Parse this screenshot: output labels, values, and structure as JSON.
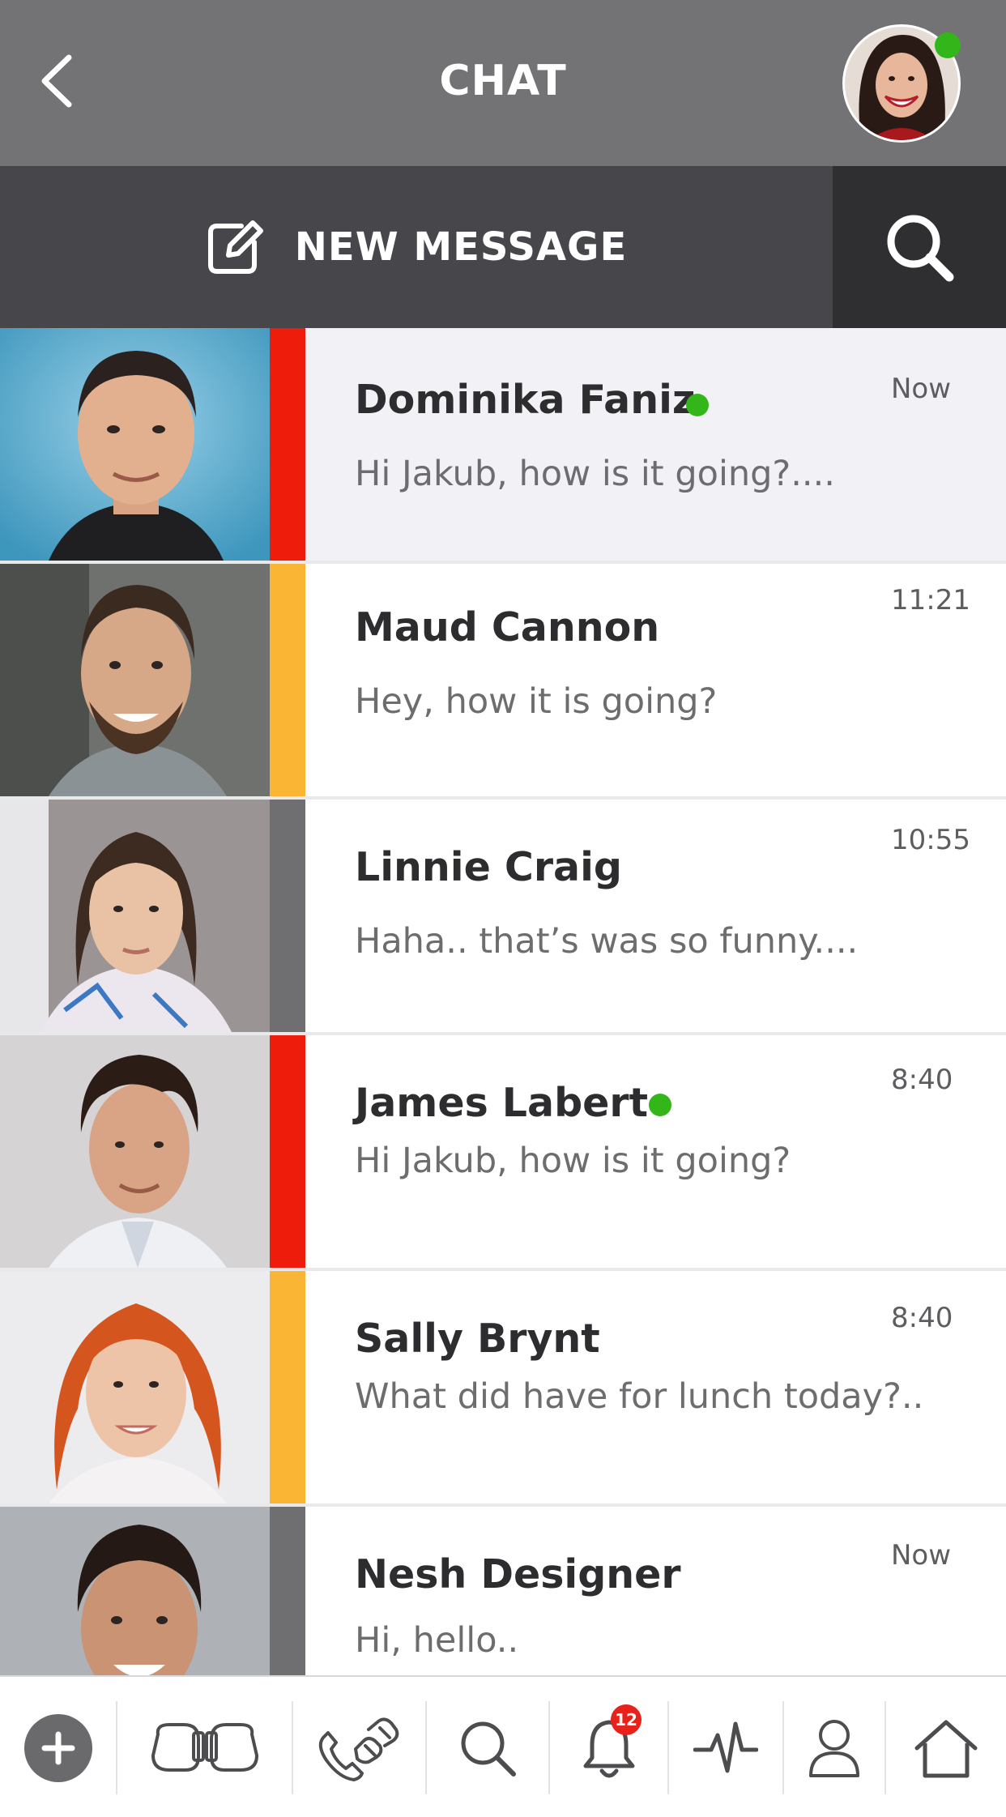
{
  "header": {
    "title": "CHAT",
    "back_icon": "chevron-left-icon",
    "profile_online": true
  },
  "actions": {
    "new_message_label": "NEW MESSAGE",
    "new_message_icon": "edit-icon",
    "search_icon": "search-icon"
  },
  "colors": {
    "header_bg": "#737274",
    "action_bg": "#47474b",
    "search_bg": "#2f2f32",
    "online": "#33b61a",
    "stripe_red": "#ee1c0a",
    "stripe_yellow": "#fbb534",
    "stripe_gray": "#6f6f72",
    "badge": "#e8221b"
  },
  "chats": [
    {
      "name": "Dominika Faniz",
      "preview": "Hi Jakub, how is it going?....",
      "time": "Now",
      "online": true,
      "stripe": "red",
      "active": true
    },
    {
      "name": "Maud Cannon",
      "preview": "Hey, how it is going?",
      "time": "11:21",
      "online": false,
      "stripe": "yellow",
      "active": false
    },
    {
      "name": "Linnie Craig",
      "preview": "Haha.. that’s was so funny....",
      "time": "10:55",
      "online": false,
      "stripe": "gray",
      "active": false
    },
    {
      "name": "James Labert",
      "preview": "Hi Jakub, how is it going?",
      "time": "8:40",
      "online": true,
      "stripe": "red",
      "active": false
    },
    {
      "name": "Sally Brynt",
      "preview": "What did have for lunch today?..",
      "time": "8:40",
      "online": false,
      "stripe": "yellow",
      "active": false
    },
    {
      "name": "Nesh Designer",
      "preview": "Hi, hello..",
      "time": "Now",
      "online": false,
      "stripe": "gray",
      "active": false
    }
  ],
  "bottom_nav": {
    "items": [
      {
        "icon": "plus-circle-icon"
      },
      {
        "icon": "boxing-gloves-icon"
      },
      {
        "icon": "phone-gloves-icon"
      },
      {
        "icon": "search-icon"
      },
      {
        "icon": "bell-icon",
        "badge": "12"
      },
      {
        "icon": "activity-icon"
      },
      {
        "icon": "user-icon"
      },
      {
        "icon": "home-icon"
      }
    ]
  }
}
